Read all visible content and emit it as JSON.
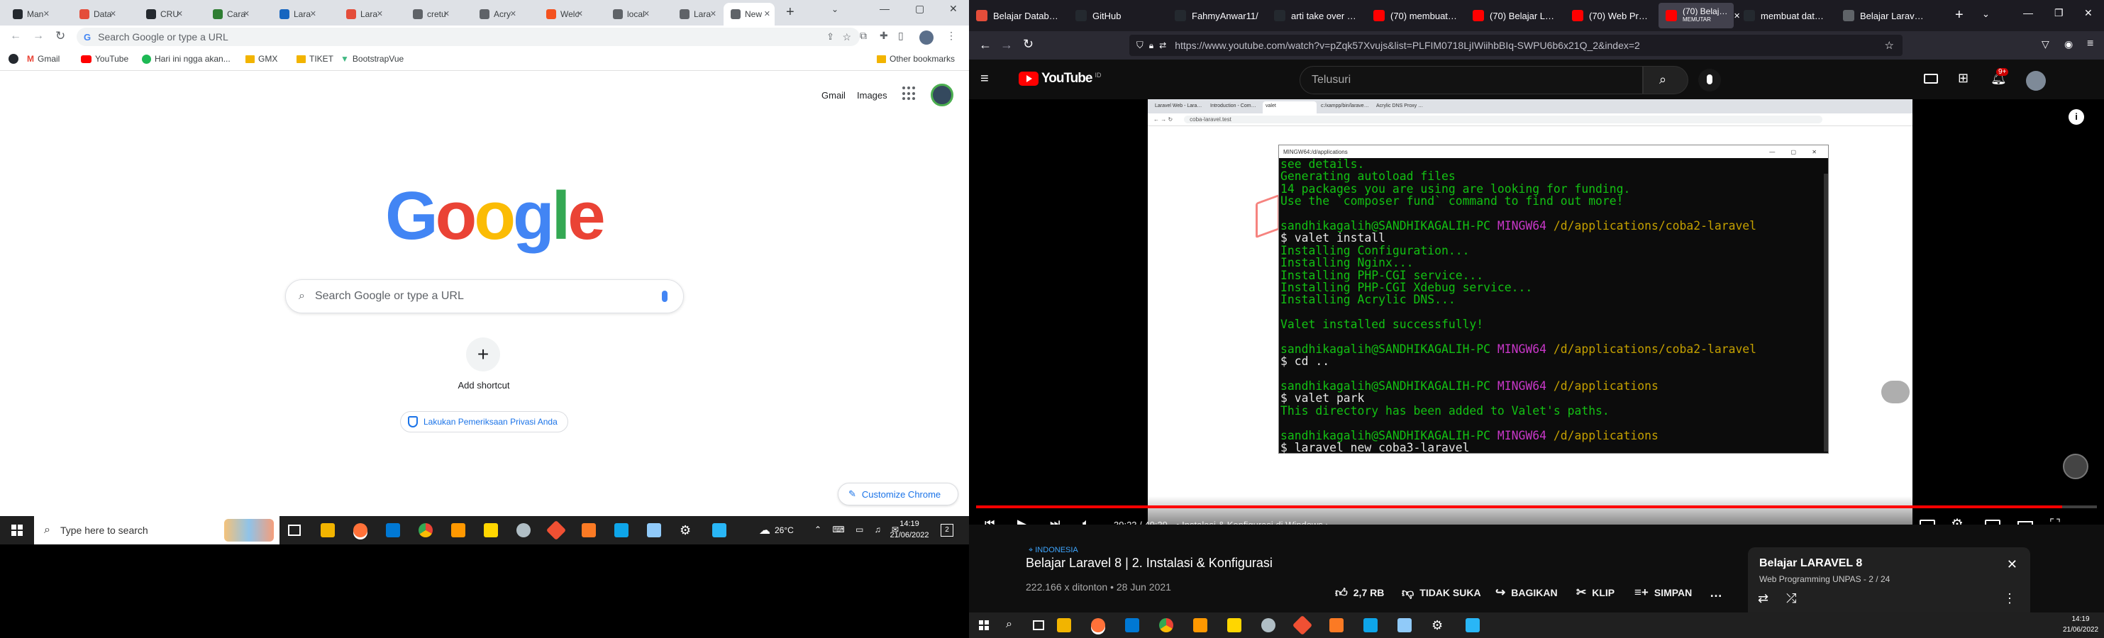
{
  "chrome": {
    "tabs": [
      {
        "label": "Man",
        "color": "#24292f"
      },
      {
        "label": "Data",
        "color": "#e44d3a"
      },
      {
        "label": "CRU",
        "color": "#24292f"
      },
      {
        "label": "Cara",
        "color": "#2e7d32"
      },
      {
        "label": "Lara",
        "color": "#1565c0"
      },
      {
        "label": "Lara",
        "color": "#e44d3a"
      },
      {
        "label": "cretu",
        "color": "#5f6368"
      },
      {
        "label": "Acry",
        "color": "#5f6368"
      },
      {
        "label": "Welc",
        "color": "#f4511e"
      },
      {
        "label": "local",
        "color": "#5f6368"
      },
      {
        "label": "Lara",
        "color": "#5f6368"
      },
      {
        "label": "New",
        "color": "#5f6368"
      }
    ],
    "omnibox_placeholder": "Search Google or type a URL",
    "bookmarks": [
      "Gmail",
      "YouTube",
      "Hari ini ngga akan...",
      "GMX",
      "TIKET",
      "BootstrapVue"
    ],
    "other_bookmarks": "Other bookmarks",
    "header_links": {
      "gmail": "Gmail",
      "images": "Images"
    },
    "search_placeholder": "Search Google or type a URL",
    "add_shortcut": "Add shortcut",
    "privacy_check": "Lakukan Pemeriksaan Privasi Anda",
    "customize": "Customize Chrome"
  },
  "win_left": {
    "search": "Type here to search",
    "weather": "26°C",
    "time": "14:19",
    "date": "21/06/2022",
    "notif": "2"
  },
  "firefox": {
    "tabs": [
      "Belajar Database",
      "GitHub",
      "FahmyAnwar11/",
      "arti take over run",
      "(70) membuat da",
      "(70) Belajar Lara",
      "(70) Web Program",
      "(70) Belajar La",
      "membuat databa",
      "Belajar Laravel 8"
    ],
    "active_sub": "MEMUTAR",
    "url": "https://www.youtube.com/watch?v=pZqk57Xvujs&list=PLFIM0718LjIWiihbBIq-SWPU6b6x21Q_2&index=2"
  },
  "youtube": {
    "logo": "YouTube",
    "region": "ID",
    "search_placeholder": "Telusuri",
    "notifications": "9+",
    "time": "39:23 / 40:39",
    "chapter": "Instalasi & Konfigurasi di Windows",
    "progress": 0.969,
    "location": "INDONESIA",
    "title": "Belajar Laravel 8 | 2. Instalasi & Konfigurasi",
    "meta": "222.166 x ditonton • 28 Jun 2021",
    "likes": "2,7 RB",
    "dislike": "TIDAK SUKA",
    "share": "BAGIKAN",
    "clip": "KLIP",
    "save": "SIMPAN",
    "playlist_title": "Belajar LARAVEL 8",
    "playlist_sub": "Web Programming UNPAS - 2 / 24",
    "in_video": {
      "tabs": [
        "Laravel Web - Laravel - The PHP...",
        "Introduction - Composer",
        "valet",
        "c:/xampp/bin/laravel-windows - Fi...",
        "Acrylic DNS Proxy Windows | M..."
      ],
      "url": "coba-laravel.test",
      "term_title": "MINGW64:/d/applications",
      "term_lines": [
        {
          "t": "see details.",
          "c": "#13c113"
        },
        {
          "t": "Generating autoload files",
          "c": "#13c113"
        },
        {
          "t": "14 packages you are using are looking for funding.",
          "c": "#13c113"
        },
        {
          "t": "Use the `composer fund` command to find out more!",
          "c": "#13c113"
        },
        {
          "t": "",
          "c": "#ccc"
        },
        {
          "t": "sandhikagalih@SANDHIKAGALIH-PC ",
          "c": "#13c113",
          "m": "MINGW64 ",
          "p": "/d/applications/coba2-laravel"
        },
        {
          "t": "$ valet install",
          "c": "#e6e6e6"
        },
        {
          "t": "Installing Configuration...",
          "c": "#13c113"
        },
        {
          "t": "Installing Nginx...",
          "c": "#13c113"
        },
        {
          "t": "Installing PHP-CGI service...",
          "c": "#13c113"
        },
        {
          "t": "Installing PHP-CGI Xdebug service...",
          "c": "#13c113"
        },
        {
          "t": "Installing Acrylic DNS...",
          "c": "#13c113"
        },
        {
          "t": "",
          "c": "#ccc"
        },
        {
          "t": "Valet installed successfully!",
          "c": "#13c113"
        },
        {
          "t": "",
          "c": "#ccc"
        },
        {
          "t": "sandhikagalih@SANDHIKAGALIH-PC ",
          "c": "#13c113",
          "m": "MINGW64 ",
          "p": "/d/applications/coba2-laravel"
        },
        {
          "t": "$ cd ..",
          "c": "#e6e6e6"
        },
        {
          "t": "",
          "c": "#ccc"
        },
        {
          "t": "sandhikagalih@SANDHIKAGALIH-PC ",
          "c": "#13c113",
          "m": "MINGW64 ",
          "p": "/d/applications"
        },
        {
          "t": "$ valet park",
          "c": "#e6e6e6"
        },
        {
          "t": "This directory has been added to Valet's paths.",
          "c": "#13c113"
        },
        {
          "t": "",
          "c": "#ccc"
        },
        {
          "t": "sandhikagalih@SANDHIKAGALIH-PC ",
          "c": "#13c113",
          "m": "MINGW64 ",
          "p": "/d/applications"
        },
        {
          "t": "$ laravel new coba3-laravel",
          "c": "#e6e6e6"
        }
      ]
    }
  },
  "win_right": {
    "time": "14:19",
    "date": "21/06/2022"
  },
  "colors": {
    "yt_red": "#ff0000",
    "chrome_blue": "#1a73e8"
  }
}
